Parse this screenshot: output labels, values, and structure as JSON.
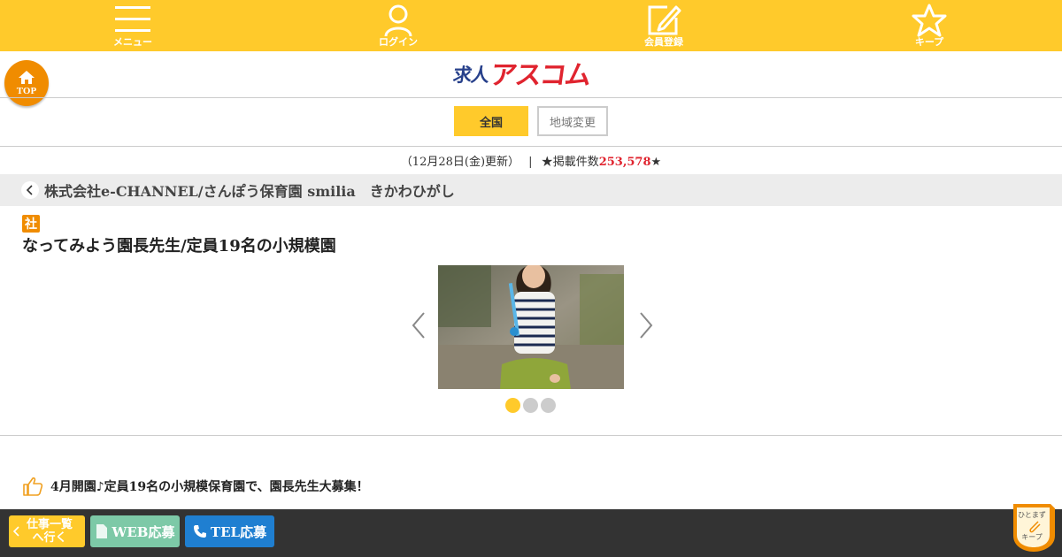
{
  "topnav": {
    "items": [
      {
        "label": "メニュー",
        "icon": "hamburger-menu-icon"
      },
      {
        "label": "ログイン",
        "icon": "person-icon"
      },
      {
        "label": "会員登録",
        "icon": "edit-square-icon"
      },
      {
        "label": "キープ",
        "icon": "star-icon"
      }
    ]
  },
  "top_button": {
    "label": "TOP",
    "icon": "home-icon"
  },
  "logo": {
    "part1": "求人",
    "part2": "アスコム"
  },
  "region": {
    "all_label": "全国",
    "change_label": "地域変更"
  },
  "stats": {
    "updated": "（12月28日(金)更新）",
    "separator": "|",
    "count_prefix": "★掲載件数",
    "count": "253,578",
    "count_suffix": "★"
  },
  "company": {
    "name": "株式会社e-CHANNEL/さんぽう保育園 smilia　きかわひがし"
  },
  "job": {
    "badge": "社",
    "title": "なってみよう園長先生/定員19名の小規模園",
    "slides": 3,
    "active_slide": 1,
    "catch": "4月開園♪定員19名の小規模保育園で、園長先生大募集！"
  },
  "bottombar": {
    "list_label_line1": "仕事一覧",
    "list_label_line2": "へ行く",
    "web_label": "WEB応募",
    "tel_label": "TEL応募"
  },
  "keep_float": {
    "line1": "ひとまず",
    "line2": "キープ"
  },
  "colors": {
    "accent": "#ffca2b",
    "orange": "#f08c00",
    "red": "#e0242f",
    "navy": "#27408b",
    "web": "#7dc9a7",
    "tel": "#1f7fd1",
    "bar": "#333333"
  }
}
